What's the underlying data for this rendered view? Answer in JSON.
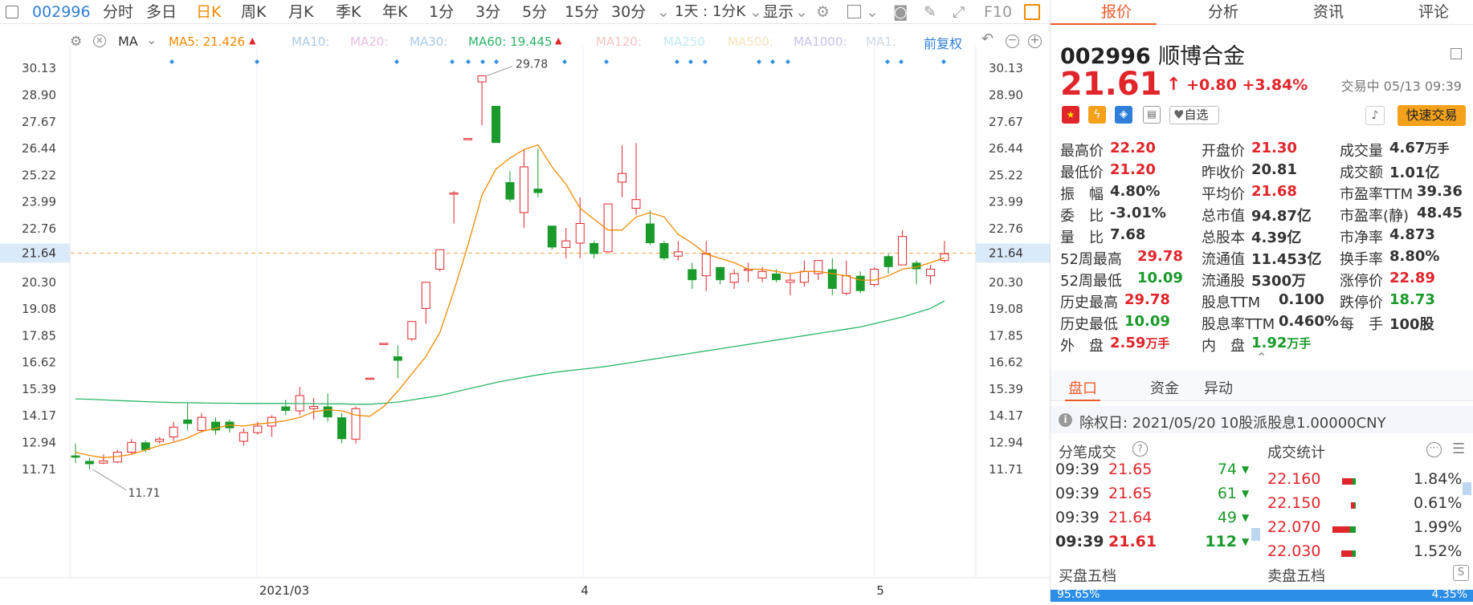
{
  "toolbar": {
    "code": "002996",
    "items": [
      "分时",
      "多日",
      "日K",
      "周K",
      "月K",
      "季K",
      "年K",
      "1分",
      "3分",
      "5分",
      "15分",
      "30分"
    ],
    "combo": "1天 : 1分K",
    "display": "显示",
    "f10": "F10"
  },
  "ma_bar": {
    "ma": "MA",
    "ma5": "MA5: 21.426",
    "ma10": "MA10:",
    "ma20": "MA20:",
    "ma30": "MA30:",
    "ma60": "MA60: 19.445",
    "ma120": "MA120:",
    "ma250": "MA250",
    "ma500": "MA500:",
    "ma1000": "MA1000:",
    "ma1": "MA1:",
    "fuquan": "前复权"
  },
  "colors": {
    "up": "#e0252b",
    "down": "#1a9a2a",
    "ma5": "#f08a00",
    "ma60": "#2cb56a",
    "accent": "#f05a28",
    "blue": "#2f7fd8"
  },
  "chart_data": {
    "type": "candlestick",
    "y_ticks": [
      "30.13",
      "28.90",
      "27.67",
      "26.44",
      "25.22",
      "23.99",
      "22.76",
      "21.64",
      "20.30",
      "19.08",
      "17.85",
      "16.62",
      "15.39",
      "14.17",
      "12.94",
      "11.71"
    ],
    "x_labels": [
      "2021/03",
      "4",
      "5"
    ],
    "current_price_label": "21.64",
    "high_annotation": "29.78",
    "low_annotation": "11.71",
    "candles": [
      {
        "o": 12.35,
        "c": 12.25,
        "h": 12.9,
        "l": 12.0
      },
      {
        "o": 12.1,
        "c": 11.95,
        "h": 12.25,
        "l": 11.71
      },
      {
        "o": 12.0,
        "c": 12.1,
        "h": 12.4,
        "l": 11.95
      },
      {
        "o": 12.05,
        "c": 12.5,
        "h": 12.6,
        "l": 12.0
      },
      {
        "o": 12.5,
        "c": 12.95,
        "h": 13.1,
        "l": 12.4
      },
      {
        "o": 12.95,
        "c": 12.6,
        "h": 13.05,
        "l": 12.5
      },
      {
        "o": 13.0,
        "c": 13.1,
        "h": 13.2,
        "l": 12.9
      },
      {
        "o": 13.2,
        "c": 13.65,
        "h": 13.9,
        "l": 13.0
      },
      {
        "o": 14.0,
        "c": 13.8,
        "h": 14.75,
        "l": 13.5
      },
      {
        "o": 13.5,
        "c": 14.1,
        "h": 14.3,
        "l": 13.4
      },
      {
        "o": 13.9,
        "c": 13.5,
        "h": 14.1,
        "l": 13.3
      },
      {
        "o": 13.9,
        "c": 13.6,
        "h": 14.0,
        "l": 13.4
      },
      {
        "o": 13.0,
        "c": 13.4,
        "h": 13.6,
        "l": 12.8
      },
      {
        "o": 13.4,
        "c": 13.7,
        "h": 13.9,
        "l": 13.3
      },
      {
        "o": 13.7,
        "c": 14.1,
        "h": 14.2,
        "l": 13.2
      },
      {
        "o": 14.6,
        "c": 14.4,
        "h": 14.9,
        "l": 14.2
      },
      {
        "o": 14.4,
        "c": 15.1,
        "h": 15.5,
        "l": 14.2
      },
      {
        "o": 14.5,
        "c": 14.6,
        "h": 15.0,
        "l": 14.0
      },
      {
        "o": 14.6,
        "c": 14.1,
        "h": 15.2,
        "l": 13.9
      },
      {
        "o": 14.1,
        "c": 13.1,
        "h": 14.3,
        "l": 12.9
      },
      {
        "o": 13.1,
        "c": 14.5,
        "h": 14.6,
        "l": 12.9
      },
      {
        "o": 15.9,
        "c": 15.9,
        "h": 15.9,
        "l": 15.9
      },
      {
        "o": 17.5,
        "c": 17.5,
        "h": 17.5,
        "l": 17.5
      },
      {
        "o": 16.9,
        "c": 16.7,
        "h": 17.4,
        "l": 15.9
      },
      {
        "o": 17.7,
        "c": 18.5,
        "h": 18.5,
        "l": 17.6
      },
      {
        "o": 19.1,
        "c": 20.3,
        "h": 20.3,
        "l": 18.4
      },
      {
        "o": 20.9,
        "c": 21.8,
        "h": 21.8,
        "l": 20.8
      },
      {
        "o": 24.4,
        "c": 24.4,
        "h": 24.5,
        "l": 23.0
      },
      {
        "o": 26.9,
        "c": 26.9,
        "h": 26.9,
        "l": 26.9
      },
      {
        "o": 29.5,
        "c": 29.78,
        "h": 29.78,
        "l": 27.5
      },
      {
        "o": 28.4,
        "c": 26.7,
        "h": 28.4,
        "l": 26.7
      },
      {
        "o": 24.9,
        "c": 24.1,
        "h": 25.4,
        "l": 24.0
      },
      {
        "o": 23.5,
        "c": 25.6,
        "h": 26.4,
        "l": 22.8
      },
      {
        "o": 24.6,
        "c": 24.4,
        "h": 26.44,
        "l": 24.2
      },
      {
        "o": 22.9,
        "c": 21.9,
        "h": 22.9,
        "l": 21.8
      },
      {
        "o": 21.9,
        "c": 22.2,
        "h": 22.8,
        "l": 21.4
      },
      {
        "o": 22.1,
        "c": 23.0,
        "h": 24.2,
        "l": 21.4
      },
      {
        "o": 22.1,
        "c": 21.6,
        "h": 22.2,
        "l": 21.4
      },
      {
        "o": 21.7,
        "c": 23.9,
        "h": 23.9,
        "l": 21.7
      },
      {
        "o": 24.9,
        "c": 25.3,
        "h": 26.6,
        "l": 24.2
      },
      {
        "o": 23.7,
        "c": 24.1,
        "h": 26.7,
        "l": 23.4
      },
      {
        "o": 23.0,
        "c": 22.1,
        "h": 23.6,
        "l": 22.0
      },
      {
        "o": 22.1,
        "c": 21.4,
        "h": 22.2,
        "l": 21.3
      },
      {
        "o": 21.5,
        "c": 21.7,
        "h": 22.2,
        "l": 21.3
      },
      {
        "o": 20.9,
        "c": 20.4,
        "h": 21.2,
        "l": 20.0
      },
      {
        "o": 20.6,
        "c": 21.6,
        "h": 22.2,
        "l": 19.9
      },
      {
        "o": 21.0,
        "c": 20.4,
        "h": 21.0,
        "l": 20.2
      },
      {
        "o": 20.3,
        "c": 20.7,
        "h": 20.9,
        "l": 20.0
      },
      {
        "o": 20.9,
        "c": 20.9,
        "h": 21.2,
        "l": 20.3
      },
      {
        "o": 20.5,
        "c": 20.8,
        "h": 21.0,
        "l": 20.3
      },
      {
        "o": 20.7,
        "c": 20.4,
        "h": 20.9,
        "l": 20.3
      },
      {
        "o": 20.3,
        "c": 20.4,
        "h": 20.7,
        "l": 19.7
      },
      {
        "o": 20.3,
        "c": 20.8,
        "h": 21.3,
        "l": 20.1
      },
      {
        "o": 20.7,
        "c": 21.3,
        "h": 21.3,
        "l": 20.4
      },
      {
        "o": 20.9,
        "c": 20.0,
        "h": 21.4,
        "l": 19.7
      },
      {
        "o": 19.8,
        "c": 20.6,
        "h": 21.3,
        "l": 19.7
      },
      {
        "o": 20.6,
        "c": 19.9,
        "h": 20.8,
        "l": 19.8
      },
      {
        "o": 20.2,
        "c": 20.9,
        "h": 21.0,
        "l": 20.1
      },
      {
        "o": 21.5,
        "c": 21.0,
        "h": 21.6,
        "l": 20.7
      },
      {
        "o": 21.1,
        "c": 22.4,
        "h": 22.7,
        "l": 21.1
      },
      {
        "o": 21.2,
        "c": 20.9,
        "h": 21.3,
        "l": 20.2
      },
      {
        "o": 20.6,
        "c": 20.9,
        "h": 21.1,
        "l": 20.2
      },
      {
        "o": 21.3,
        "c": 21.61,
        "h": 22.2,
        "l": 21.2
      }
    ],
    "ma5": [
      12.5,
      12.35,
      12.25,
      12.3,
      12.4,
      12.6,
      12.8,
      12.95,
      13.15,
      13.45,
      13.6,
      13.75,
      13.7,
      13.8,
      13.85,
      13.95,
      14.1,
      14.35,
      14.45,
      14.4,
      14.2,
      14.15,
      14.6,
      15.3,
      16.1,
      16.9,
      18.0,
      19.9,
      22.0,
      24.3,
      25.5,
      26.0,
      26.4,
      26.6,
      25.6,
      24.8,
      23.7,
      23.2,
      22.7,
      22.7,
      23.3,
      23.5,
      23.3,
      22.5,
      22.1,
      21.6,
      21.4,
      21.2,
      20.9,
      20.9,
      20.8,
      20.7,
      20.8,
      20.8,
      20.7,
      20.6,
      20.4,
      20.4,
      20.6,
      20.9,
      21.0,
      21.2,
      21.426
    ],
    "ma60": [
      14.95,
      14.93,
      14.9,
      14.87,
      14.85,
      14.82,
      14.8,
      14.78,
      14.77,
      14.76,
      14.75,
      14.75,
      14.74,
      14.74,
      14.74,
      14.74,
      14.73,
      14.73,
      14.72,
      14.72,
      14.7,
      14.7,
      14.75,
      14.8,
      14.9,
      15.0,
      15.1,
      15.25,
      15.4,
      15.55,
      15.7,
      15.82,
      15.94,
      16.05,
      16.15,
      16.23,
      16.3,
      16.37,
      16.45,
      16.55,
      16.65,
      16.75,
      16.85,
      16.95,
      17.05,
      17.15,
      17.25,
      17.35,
      17.45,
      17.55,
      17.65,
      17.75,
      17.85,
      17.95,
      18.05,
      18.15,
      18.25,
      18.4,
      18.55,
      18.7,
      18.9,
      19.1,
      19.445
    ]
  },
  "quote": {
    "code": "002996",
    "name": "顺博合金",
    "price": "21.61",
    "arrow": "↑",
    "change": "+0.80",
    "pct": "+3.84%",
    "status": "交易中 05/13 09:39",
    "watch": "自选",
    "trade_btn": "快速交易"
  },
  "tabs": [
    "报价",
    "分析",
    "资讯",
    "评论"
  ],
  "fields": [
    {
      "label": "最高价",
      "value": "22.20",
      "color": "red"
    },
    {
      "label": "开盘价",
      "value": "21.30",
      "color": "red"
    },
    {
      "label": "成交量",
      "value": "4.67",
      "unit": "万手",
      "color": "blk"
    },
    {
      "label": "最低价",
      "value": "21.20",
      "color": "red"
    },
    {
      "label": "昨收价",
      "value": "20.81",
      "color": "blk"
    },
    {
      "label": "成交额",
      "value": "1.01亿",
      "color": "blk"
    },
    {
      "label": "振　幅",
      "value": "4.80%",
      "color": "blk"
    },
    {
      "label": "平均价",
      "value": "21.68",
      "color": "red"
    },
    {
      "label": "市盈率TTM",
      "value": "39.36",
      "color": "blk"
    },
    {
      "label": "委　比",
      "value": "-3.01%",
      "color": "blk"
    },
    {
      "label": "总市值",
      "value": "94.87亿",
      "color": "blk"
    },
    {
      "label": "市盈率(静)",
      "value": "48.45",
      "color": "blk"
    },
    {
      "label": "量　比",
      "value": "7.68",
      "color": "blk"
    },
    {
      "label": "总股本",
      "value": "4.39亿",
      "color": "blk"
    },
    {
      "label": "市净率",
      "value": "4.873",
      "color": "blk"
    },
    {
      "label": "52周最高",
      "value": "29.78",
      "color": "red"
    },
    {
      "label": "流通值",
      "value": "11.453亿",
      "color": "blk"
    },
    {
      "label": "换手率",
      "value": "8.80%",
      "color": "blk"
    },
    {
      "label": "52周最低",
      "value": "10.09",
      "color": "green"
    },
    {
      "label": "流通股",
      "value": "5300万",
      "color": "blk"
    },
    {
      "label": "涨停价",
      "value": "22.89",
      "color": "red"
    },
    {
      "label": "历史最高",
      "value": "29.78",
      "color": "red"
    },
    {
      "label": "股息TTM",
      "value": "0.100",
      "color": "blk"
    },
    {
      "label": "跌停价",
      "value": "18.73",
      "color": "green"
    },
    {
      "label": "历史最低",
      "value": "10.09",
      "color": "green"
    },
    {
      "label": "股息率TTM",
      "value": "0.460%",
      "color": "blk"
    },
    {
      "label": "每　手",
      "value": "100股",
      "color": "blk"
    },
    {
      "label": "外　盘",
      "value": "2.59",
      "unit": "万手",
      "color": "red"
    },
    {
      "label": "内　盘",
      "value": "1.92",
      "unit": "万手",
      "color": "green"
    }
  ],
  "sub_tabs": [
    "盘口",
    "资金",
    "异动"
  ],
  "notice": "除权日: 2021/05/20  10股派股息1.00000CNY",
  "ticks_title": "分笔成交",
  "ticks": [
    {
      "time": "09:39",
      "price": "21.65",
      "vol": "74"
    },
    {
      "time": "09:39",
      "price": "21.65",
      "vol": "61"
    },
    {
      "time": "09:39",
      "price": "21.64",
      "vol": "49"
    },
    {
      "time": "09:39",
      "price": "21.61",
      "vol": "112"
    }
  ],
  "stats_title": "成交统计",
  "stats": [
    {
      "price": "22.160",
      "pct": "1.84%",
      "ratio": 0.55
    },
    {
      "price": "22.150",
      "pct": "0.61%",
      "ratio": 0.1
    },
    {
      "price": "22.070",
      "pct": "1.99%",
      "ratio": 0.95
    },
    {
      "price": "22.030",
      "pct": "1.52%",
      "ratio": 0.6
    }
  ],
  "bid_title": "买盘五档",
  "ask_title": "卖盘五档",
  "bid_ratio": "95.65%",
  "ask_ratio": "4.35%"
}
